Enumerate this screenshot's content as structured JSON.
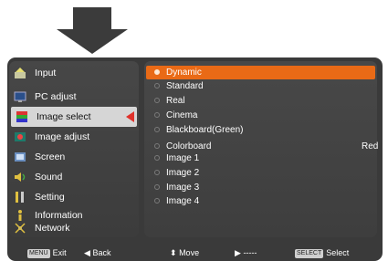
{
  "menu": {
    "items": [
      {
        "label": "Input",
        "icon": "input-icon"
      },
      {
        "label": "PC adjust",
        "icon": "monitor-icon"
      },
      {
        "label": "Image select",
        "icon": "image-select-icon"
      },
      {
        "label": "Image adjust",
        "icon": "image-adjust-icon"
      },
      {
        "label": "Screen",
        "icon": "screen-icon"
      },
      {
        "label": "Sound",
        "icon": "sound-icon"
      },
      {
        "label": "Setting",
        "icon": "setting-icon"
      },
      {
        "label": "Information",
        "icon": "information-icon"
      },
      {
        "label": "Network",
        "icon": "network-icon"
      }
    ],
    "selected": "Image select"
  },
  "options": [
    {
      "label": "Dynamic",
      "value": ""
    },
    {
      "label": "Standard",
      "value": ""
    },
    {
      "label": "Real",
      "value": ""
    },
    {
      "label": "Cinema",
      "value": ""
    },
    {
      "label": "Blackboard(Green)",
      "value": ""
    },
    {
      "label": "Colorboard",
      "value": "Red"
    },
    {
      "label": "Image 1",
      "value": ""
    },
    {
      "label": "Image 2",
      "value": ""
    },
    {
      "label": "Image 3",
      "value": ""
    },
    {
      "label": "Image 4",
      "value": ""
    }
  ],
  "selected_option": "Dynamic",
  "bottom_bar": {
    "exit_key": "MENU",
    "exit_label": "Exit",
    "back_label": "Back",
    "move_label": "Move",
    "next_label": "-----",
    "select_key": "SELECT",
    "select_label": "Select"
  },
  "colors": {
    "highlight": "#e96a16",
    "selected_arrow": "#e0312a",
    "frame": "#3a3a3a"
  }
}
